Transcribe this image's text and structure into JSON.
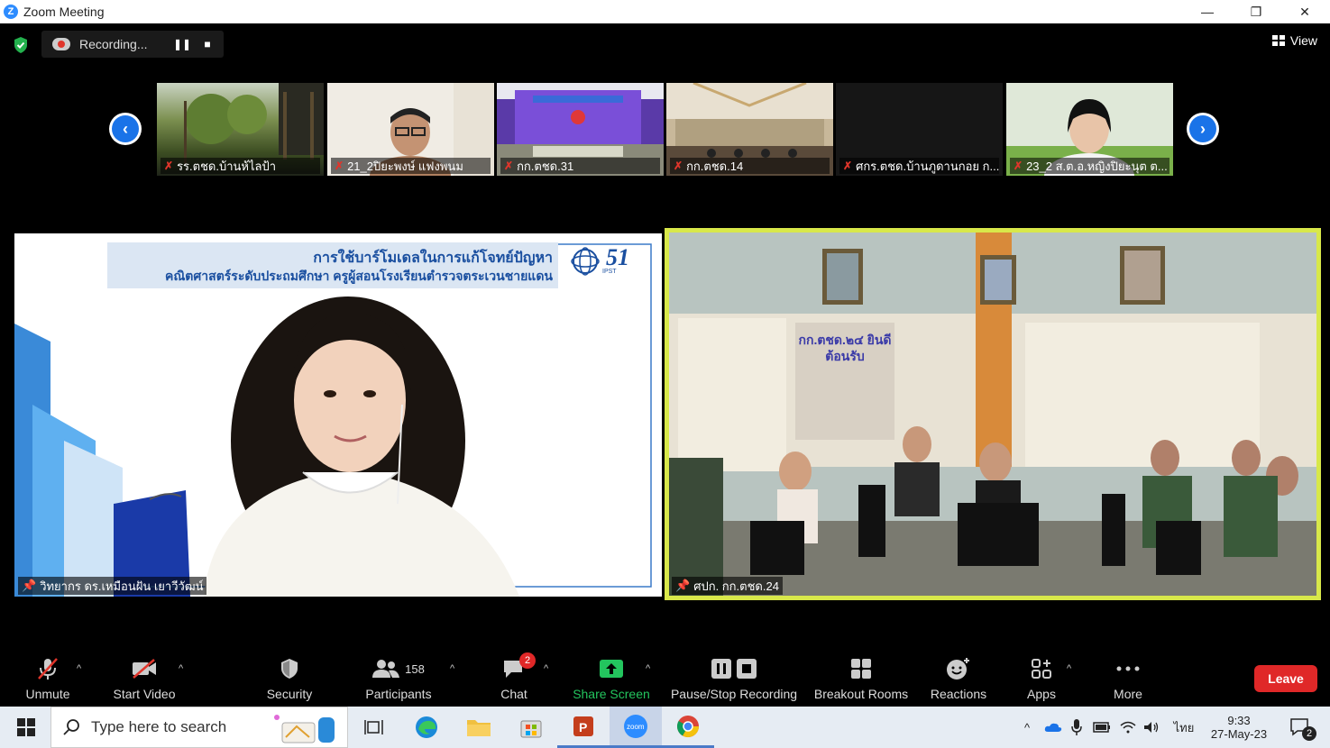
{
  "window": {
    "title": "Zoom Meeting",
    "minimize": "—",
    "restore": "❐",
    "close": "✕"
  },
  "recording": {
    "label": "Recording...",
    "pause_icon": "❚❚",
    "stop_icon": "■"
  },
  "view": {
    "label": "View"
  },
  "strip": {
    "thumbnails": [
      {
        "label": "รร.ตชด.บ้านห้ไลป้า"
      },
      {
        "label": "21_2ปิยะพงษ์ แฟงพนม"
      },
      {
        "label": "กก.ตชด.31"
      },
      {
        "label": "กก.ตชด.14"
      },
      {
        "label": "ศกร.ตชด.บ้านภูดานกอย ก..."
      },
      {
        "label": "23_2 ส.ต.อ.หญิงปิยะนุต  ต..."
      }
    ]
  },
  "slide": {
    "line1": "การใช้บาร์โมเดลในการแก้โจทย์ปัญหา",
    "line2": "คณิตศาสตร์ระดับประถมศึกษา ครูผู้สอนโรงเรียนตำรวจตระเวนชายแดน",
    "logo_number": "51",
    "logo_sub": "IPST"
  },
  "main_left": {
    "label": "วิทยากร ดร.เหมือนฝัน เยาวีวัฒน์"
  },
  "main_right": {
    "label": "ศปก. กก.ตชด.24",
    "banner": "กก.ตชด.๒๔ ยินดีต้อนรับ"
  },
  "toolbar": {
    "unmute": "Unmute",
    "start_video": "Start Video",
    "security": "Security",
    "participants": "Participants",
    "participants_count": "158",
    "chat": "Chat",
    "chat_badge": "2",
    "share_screen": "Share Screen",
    "pause_stop_recording": "Pause/Stop Recording",
    "breakout_rooms": "Breakout Rooms",
    "reactions": "Reactions",
    "apps": "Apps",
    "more": "More",
    "leave": "Leave"
  },
  "taskbar": {
    "search_placeholder": "Type here to search",
    "language": "ไทย",
    "time": "9:33",
    "date": "27-May-23",
    "notifications": "2"
  },
  "colors": {
    "accent": "#2d8cff",
    "leave": "#e02828",
    "active_speaker": "#d8e84a",
    "share_green": "#23c55e"
  }
}
